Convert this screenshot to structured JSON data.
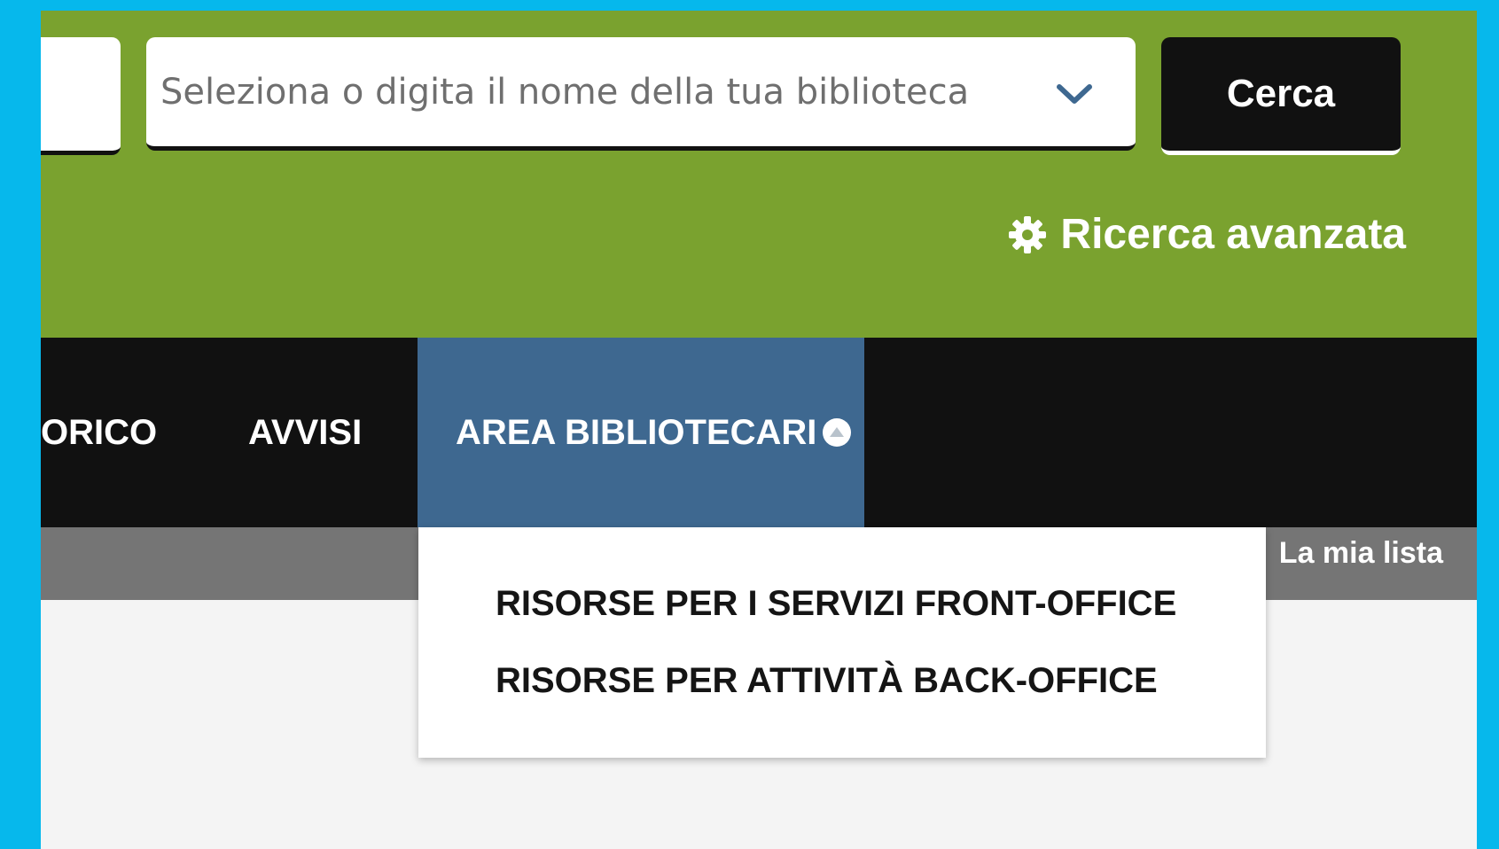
{
  "search": {
    "library_placeholder": "Seleziona o digita il nome della tua biblioteca",
    "search_button": "Cerca",
    "advanced_search": "Ricerca avanzata"
  },
  "nav": {
    "items": [
      {
        "label": "ORICO"
      },
      {
        "label": "AVVISI"
      },
      {
        "label": "AREA BIBLIOTECARI",
        "active": true
      }
    ]
  },
  "submenu": {
    "items": [
      {
        "label": "RISORSE PER I SERVIZI FRONT-OFFICE"
      },
      {
        "label": "RISORSE PER ATTIVITÀ BACK-OFFICE"
      }
    ]
  },
  "toolbar": {
    "my_list": "La mia lista"
  },
  "colors": {
    "outer_background": "#06b8ec",
    "header_green": "#7aa22f",
    "navbar": "#111111",
    "nav_active": "#3e6890",
    "gray_bar": "#757575"
  },
  "icons": {
    "select_chevron": "chevron-down-icon",
    "advanced_search": "gear-icon",
    "nav_active": "chevron-up-circle-icon"
  }
}
